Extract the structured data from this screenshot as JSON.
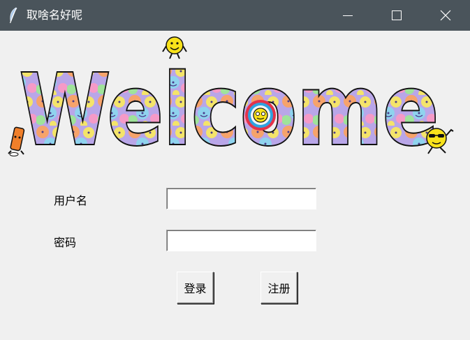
{
  "window": {
    "title": "取啥名好呢",
    "titlebar_color": "#4a545b",
    "icons": {
      "app": "feather-icon",
      "minimize": "minimize-icon",
      "maximize": "maximize-icon",
      "close": "close-icon"
    }
  },
  "banner": {
    "logo_text": "Welcome",
    "icons": [
      "smiley-waving-icon",
      "smiley-crayon-icon",
      "smiley-target-icon",
      "smiley-sunglasses-icon"
    ]
  },
  "form": {
    "username_label": "用户名",
    "username_value": "",
    "password_label": "密码",
    "password_value": ""
  },
  "buttons": {
    "login": "登录",
    "register": "注册"
  }
}
